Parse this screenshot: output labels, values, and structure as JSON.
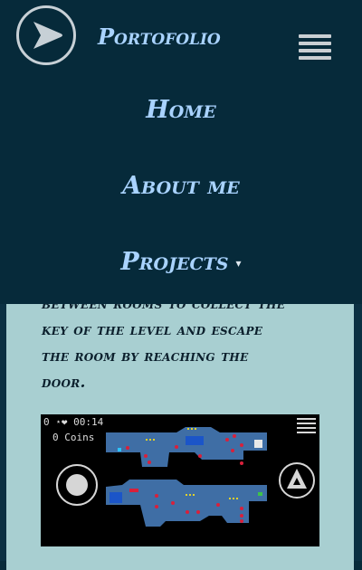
{
  "brand": {
    "name": "Portofolio"
  },
  "nav": {
    "home": "Home",
    "about": "About me",
    "projects": "Projects",
    "projects_caret": "▾"
  },
  "content": {
    "lines": [
      "between rooms to collect the",
      "key of the level and escape",
      "the room by reaching the",
      "door."
    ]
  },
  "game": {
    "hud_left": "0 ⋆❤ 00:14",
    "coins": "0 Coins"
  },
  "colors": {
    "navbar": "#062a3a",
    "nav_text": "#a9d3ff",
    "card": "#a8cfd1"
  }
}
